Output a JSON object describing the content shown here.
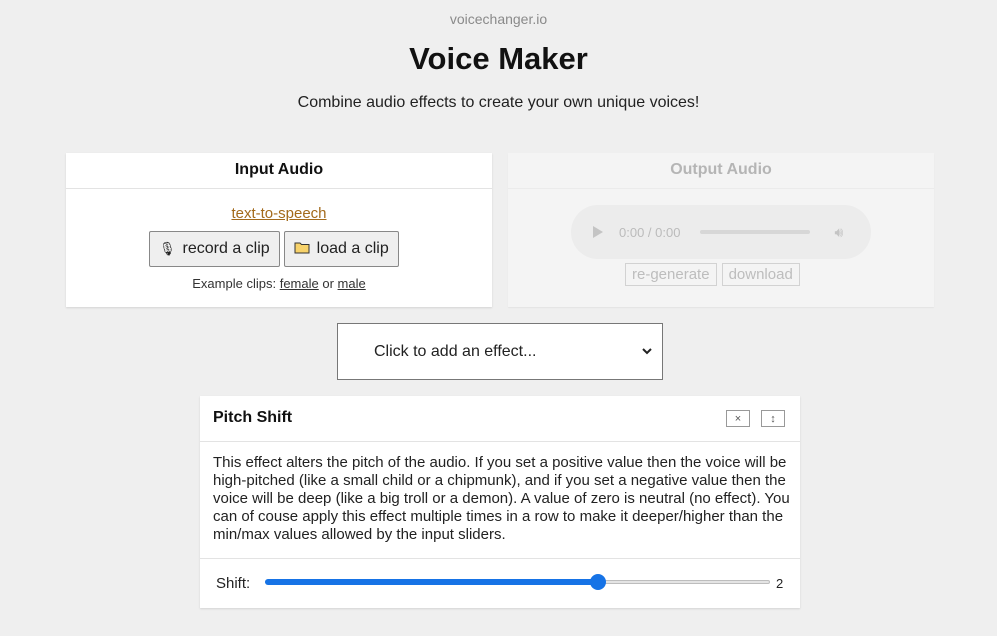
{
  "site_name": "voicechanger.io",
  "title": "Voice Maker",
  "subtitle": "Combine audio effects to create your own unique voices!",
  "input": {
    "header": "Input Audio",
    "tts_link": "text-to-speech",
    "record_label": "record a clip",
    "load_label": "load a clip",
    "examples_prefix": "Example clips:",
    "example_female": "female",
    "example_or": "or",
    "example_male": "male"
  },
  "output": {
    "header": "Output Audio",
    "time": "0:00 / 0:00",
    "regenerate_label": "re-generate",
    "download_label": "download"
  },
  "effect_select": {
    "selected": "Click to add an effect..."
  },
  "effect": {
    "title": "Pitch Shift",
    "close_symbol": "×",
    "move_symbol": "↕",
    "description": "This effect alters the pitch of the audio. If you set a positive value then the voice will be high-pitched (like a small child or a chipmunk), and if you set a negative value then the voice will be deep (like a big troll or a demon). A value of zero is neutral (no effect). You can of couse apply this effect multiple times in a row to make it deeper/higher than the min/max values allowed by the input sliders.",
    "param_label": "Shift:",
    "param_value": "2",
    "slider_fraction": 0.66
  },
  "colors": {
    "accent": "#1673e6",
    "link": "#a36a1b"
  }
}
